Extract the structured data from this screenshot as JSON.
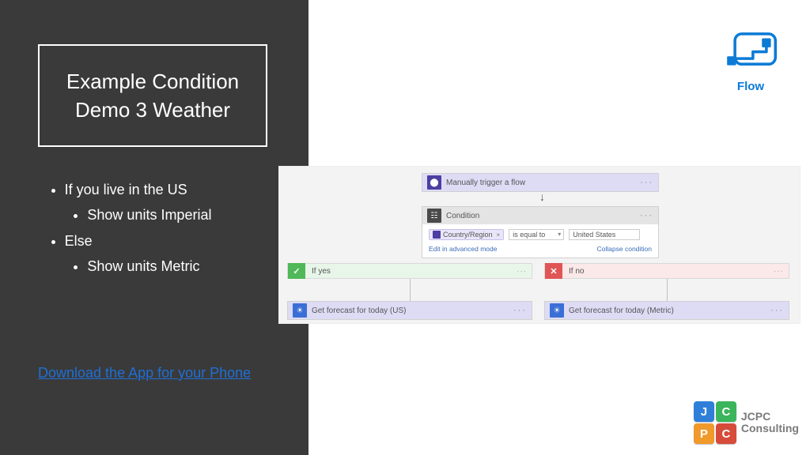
{
  "title": "Example Condition Demo 3 Weather",
  "bullets": {
    "b1": "If you live in the US",
    "b1a": "Show units Imperial",
    "b2": "Else",
    "b2a": "Show units Metric"
  },
  "download_link": "Download the App for your Phone",
  "flow_logo_label": "Flow",
  "canvas": {
    "trigger_title": "Manually trigger a flow",
    "condition_title": "Condition",
    "field_pill": "Country/Region",
    "operator": "is equal to",
    "value": "United States",
    "edit_link": "Edit in advanced mode",
    "collapse_link": "Collapse condition",
    "yes_label": "If yes",
    "no_label": "If no",
    "yes_action": "Get forecast for today (US)",
    "no_action": "Get forecast for today (Metric)"
  },
  "jcpc": {
    "j": "J",
    "c1": "C",
    "p": "P",
    "c2": "C",
    "line1": "JCPC",
    "line2": "Consulting"
  }
}
